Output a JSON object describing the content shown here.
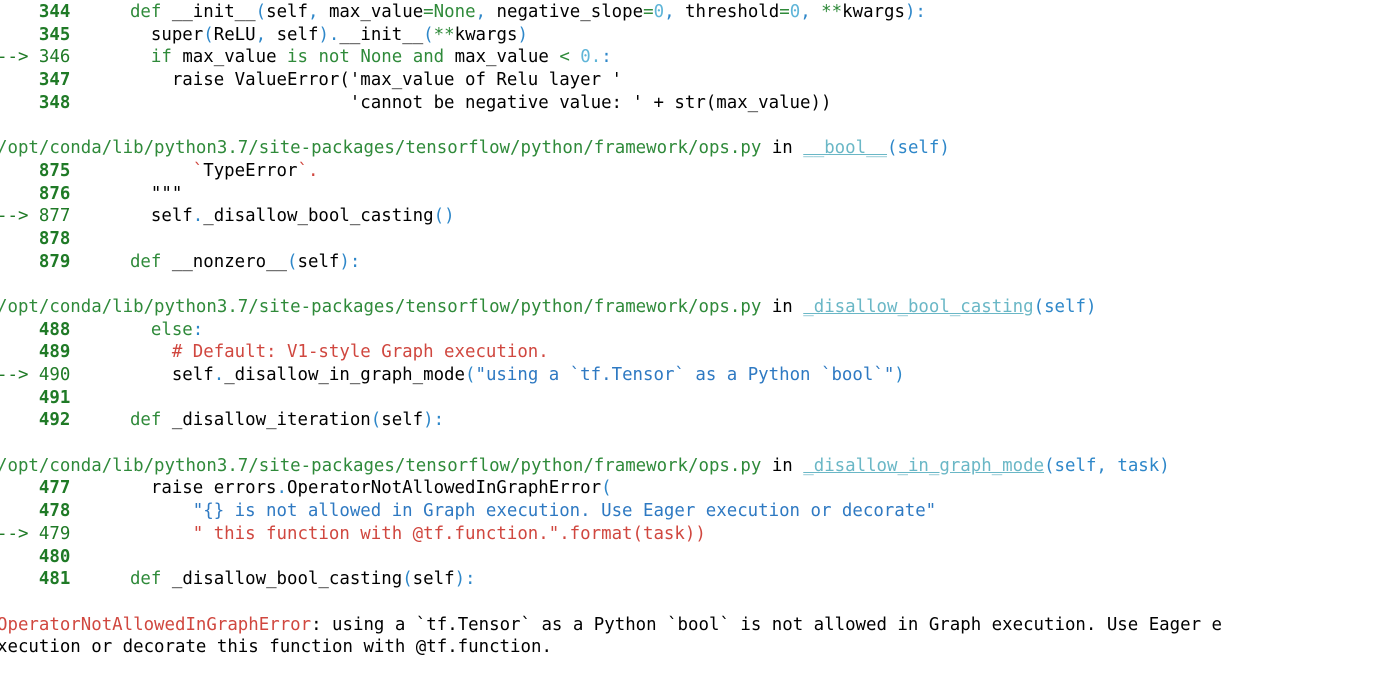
{
  "frames": [
    {
      "header": null,
      "lines": [
        {
          "num": "344",
          "current": false,
          "tokens": [
            {
              "t": "  ",
              "c": "tok"
            },
            {
              "t": "def",
              "c": "kw"
            },
            {
              "t": " __init__",
              "c": "tok"
            },
            {
              "t": "(",
              "c": "punct"
            },
            {
              "t": "self",
              "c": "tok"
            },
            {
              "t": ", ",
              "c": "punct"
            },
            {
              "t": "max_value",
              "c": "tok"
            },
            {
              "t": "=",
              "c": "op"
            },
            {
              "t": "None",
              "c": "kw"
            },
            {
              "t": ", ",
              "c": "punct"
            },
            {
              "t": "negative_slope",
              "c": "tok"
            },
            {
              "t": "=",
              "c": "op"
            },
            {
              "t": "0",
              "c": "num-lit"
            },
            {
              "t": ", ",
              "c": "punct"
            },
            {
              "t": "threshold",
              "c": "tok"
            },
            {
              "t": "=",
              "c": "op"
            },
            {
              "t": "0",
              "c": "num-lit"
            },
            {
              "t": ", ",
              "c": "punct"
            },
            {
              "t": "**",
              "c": "op"
            },
            {
              "t": "kwargs",
              "c": "tok"
            },
            {
              "t": "):",
              "c": "punct"
            }
          ]
        },
        {
          "num": "345",
          "current": false,
          "tokens": [
            {
              "t": "    super",
              "c": "tok"
            },
            {
              "t": "(",
              "c": "punct"
            },
            {
              "t": "ReLU",
              "c": "tok"
            },
            {
              "t": ", ",
              "c": "punct"
            },
            {
              "t": "self",
              "c": "tok"
            },
            {
              "t": ").",
              "c": "punct"
            },
            {
              "t": "__init__",
              "c": "tok"
            },
            {
              "t": "(",
              "c": "punct"
            },
            {
              "t": "**",
              "c": "op"
            },
            {
              "t": "kwargs",
              "c": "tok"
            },
            {
              "t": ")",
              "c": "punct"
            }
          ]
        },
        {
          "num": "346",
          "current": true,
          "tokens": [
            {
              "t": "    ",
              "c": "tok"
            },
            {
              "t": "if",
              "c": "kw"
            },
            {
              "t": " max_value ",
              "c": "tok"
            },
            {
              "t": "is",
              "c": "kw"
            },
            {
              "t": " ",
              "c": "tok"
            },
            {
              "t": "not",
              "c": "kw"
            },
            {
              "t": " ",
              "c": "tok"
            },
            {
              "t": "None",
              "c": "kw"
            },
            {
              "t": " ",
              "c": "tok"
            },
            {
              "t": "and",
              "c": "kw"
            },
            {
              "t": " max_value ",
              "c": "tok"
            },
            {
              "t": "<",
              "c": "op"
            },
            {
              "t": " ",
              "c": "tok"
            },
            {
              "t": "0.",
              "c": "num-lit"
            },
            {
              "t": ":",
              "c": "punct"
            }
          ]
        },
        {
          "num": "347",
          "current": false,
          "tokens": [
            {
              "t": "      raise ValueError('max_value of Relu layer '",
              "c": "tok"
            }
          ]
        },
        {
          "num": "348",
          "current": false,
          "tokens": [
            {
              "t": "                       'cannot be negative value: ' + str(max_value))",
              "c": "tok"
            }
          ]
        }
      ]
    },
    {
      "header": {
        "path": "/opt/conda/lib/python3.7/site-packages/tensorflow/python/framework/ops.py",
        "in": "in",
        "func": "__bool__",
        "args": "(self)"
      },
      "lines": [
        {
          "num": "875",
          "current": false,
          "tokens": [
            {
              "t": "        `",
              "c": "str-red"
            },
            {
              "t": "TypeError",
              "c": "tok"
            },
            {
              "t": "`.",
              "c": "str-red"
            }
          ]
        },
        {
          "num": "876",
          "current": false,
          "tokens": [
            {
              "t": "    \"\"\"",
              "c": "tok"
            }
          ]
        },
        {
          "num": "877",
          "current": true,
          "tokens": [
            {
              "t": "    self",
              "c": "tok"
            },
            {
              "t": ".",
              "c": "punct"
            },
            {
              "t": "_disallow_bool_casting",
              "c": "tok"
            },
            {
              "t": "()",
              "c": "punct"
            }
          ]
        },
        {
          "num": "878",
          "current": false,
          "tokens": []
        },
        {
          "num": "879",
          "current": false,
          "tokens": [
            {
              "t": "  ",
              "c": "tok"
            },
            {
              "t": "def",
              "c": "kw"
            },
            {
              "t": " __nonzero__",
              "c": "tok"
            },
            {
              "t": "(",
              "c": "punct"
            },
            {
              "t": "self",
              "c": "tok"
            },
            {
              "t": "):",
              "c": "punct"
            }
          ]
        }
      ]
    },
    {
      "header": {
        "path": "/opt/conda/lib/python3.7/site-packages/tensorflow/python/framework/ops.py",
        "in": "in",
        "func": "_disallow_bool_casting",
        "args": "(self)"
      },
      "lines": [
        {
          "num": "488",
          "current": false,
          "tokens": [
            {
              "t": "    ",
              "c": "tok"
            },
            {
              "t": "else",
              "c": "kw"
            },
            {
              "t": ":",
              "c": "punct"
            }
          ]
        },
        {
          "num": "489",
          "current": false,
          "tokens": [
            {
              "t": "      ",
              "c": "tok"
            },
            {
              "t": "# Default: V1-style Graph execution.",
              "c": "comment"
            }
          ]
        },
        {
          "num": "490",
          "current": true,
          "tokens": [
            {
              "t": "      self",
              "c": "tok"
            },
            {
              "t": ".",
              "c": "punct"
            },
            {
              "t": "_disallow_in_graph_mode",
              "c": "tok"
            },
            {
              "t": "(",
              "c": "punct"
            },
            {
              "t": "\"using a `tf.Tensor` as a Python `bool`\"",
              "c": "str"
            },
            {
              "t": ")",
              "c": "punct"
            }
          ]
        },
        {
          "num": "491",
          "current": false,
          "tokens": []
        },
        {
          "num": "492",
          "current": false,
          "tokens": [
            {
              "t": "  ",
              "c": "tok"
            },
            {
              "t": "def",
              "c": "kw"
            },
            {
              "t": " _disallow_iteration",
              "c": "tok"
            },
            {
              "t": "(",
              "c": "punct"
            },
            {
              "t": "self",
              "c": "tok"
            },
            {
              "t": "):",
              "c": "punct"
            }
          ]
        }
      ]
    },
    {
      "header": {
        "path": "/opt/conda/lib/python3.7/site-packages/tensorflow/python/framework/ops.py",
        "in": "in",
        "func": "_disallow_in_graph_mode",
        "args": "(self, task)"
      },
      "lines": [
        {
          "num": "477",
          "current": false,
          "tokens": [
            {
              "t": "    raise errors",
              "c": "tok"
            },
            {
              "t": ".",
              "c": "punct"
            },
            {
              "t": "OperatorNotAllowedInGraphError",
              "c": "tok"
            },
            {
              "t": "(",
              "c": "punct"
            }
          ]
        },
        {
          "num": "478",
          "current": false,
          "tokens": [
            {
              "t": "        ",
              "c": "tok"
            },
            {
              "t": "\"{} is not allowed in Graph execution. Use Eager execution or decorate\"",
              "c": "str"
            }
          ]
        },
        {
          "num": "479",
          "current": true,
          "tokens": [
            {
              "t": "        ",
              "c": "tok"
            },
            {
              "t": "\" this function with @tf.function.\".format(task))",
              "c": "str-red"
            }
          ]
        },
        {
          "num": "480",
          "current": false,
          "tokens": []
        },
        {
          "num": "481",
          "current": false,
          "tokens": [
            {
              "t": "  ",
              "c": "tok"
            },
            {
              "t": "def",
              "c": "kw"
            },
            {
              "t": " _disallow_bool_casting",
              "c": "tok"
            },
            {
              "t": "(",
              "c": "punct"
            },
            {
              "t": "self",
              "c": "tok"
            },
            {
              "t": "):",
              "c": "punct"
            }
          ]
        }
      ]
    }
  ],
  "error": {
    "name": "OperatorNotAllowedInGraphError",
    "line1": ": using a `tf.Tensor` as a Python `bool` is not allowed in Graph execution. Use Eager e",
    "line2": "xecution or decorate this function with @tf.function."
  },
  "arrow": "-->"
}
